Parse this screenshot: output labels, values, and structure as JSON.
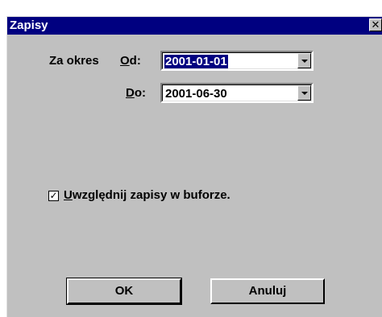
{
  "window": {
    "title": "Zapisy",
    "close_glyph": "✕"
  },
  "period": {
    "label": "Za okres",
    "from": {
      "label_mnemonic": "O",
      "label_rest": "d:",
      "value": "2001-01-01"
    },
    "to": {
      "label_mnemonic": "D",
      "label_rest": "o:",
      "value": "2001-06-30"
    }
  },
  "buffer_option": {
    "checked": true,
    "check_glyph": "✓",
    "label_mnemonic": "U",
    "label_rest": "względnij zapisy w buforze."
  },
  "buttons": {
    "ok": "OK",
    "cancel": "Anuluj"
  },
  "icons": {
    "close": "close-icon",
    "dropdown": "chevron-down-icon",
    "check": "checkmark-icon"
  }
}
